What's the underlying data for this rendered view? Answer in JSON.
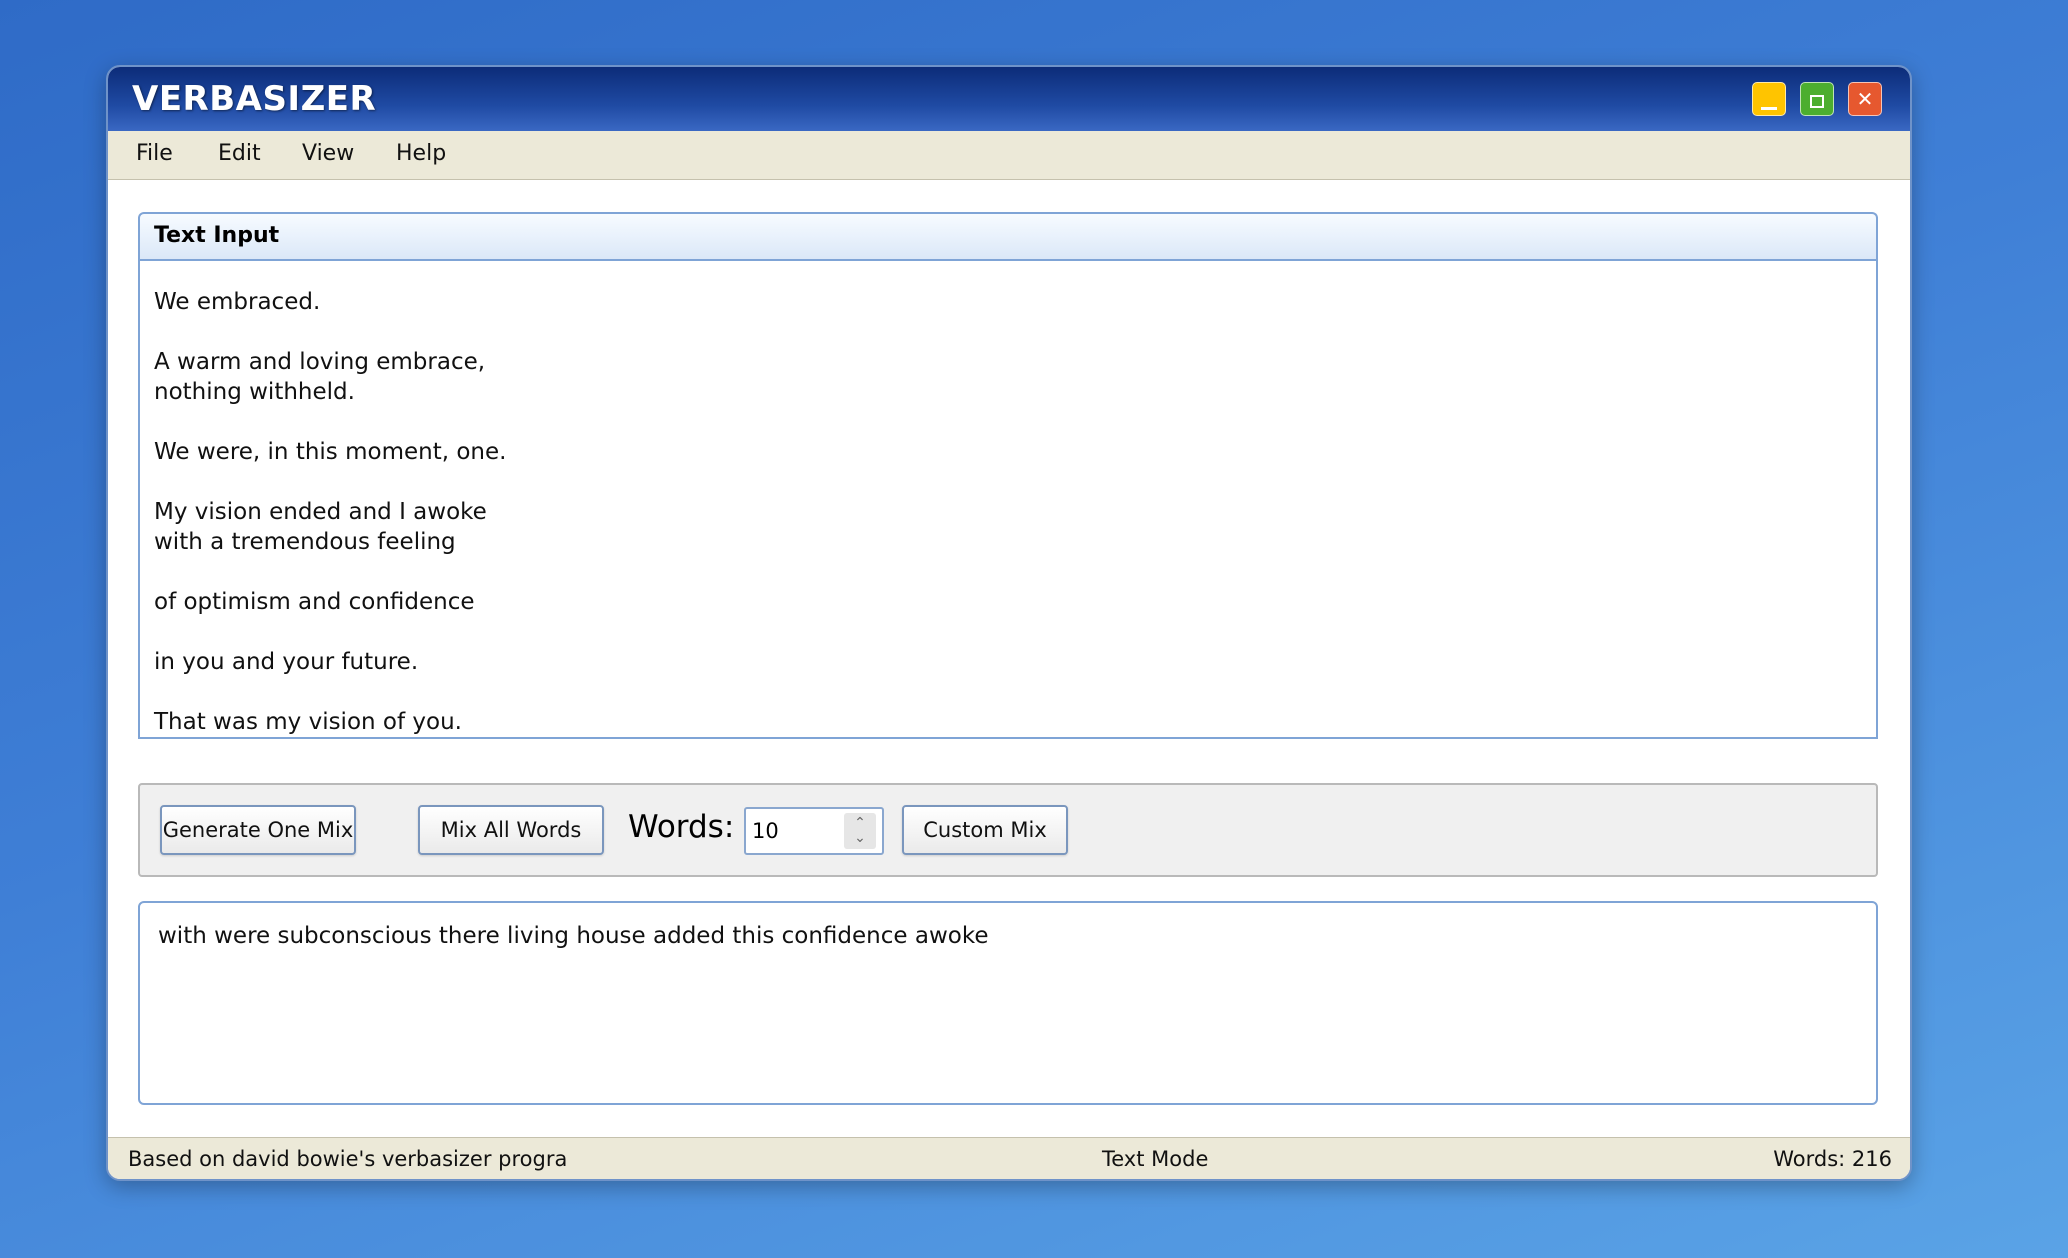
{
  "window": {
    "title": "VERBASIZER",
    "controls": {
      "minimize_icon": "minimize-icon",
      "maximize_icon": "maximize-icon",
      "close_icon": "close-icon",
      "close_glyph": "✕"
    }
  },
  "menu": {
    "items": [
      {
        "label": "File"
      },
      {
        "label": "Edit"
      },
      {
        "label": "View"
      },
      {
        "label": "Help"
      }
    ]
  },
  "input_panel": {
    "title": "Text Input",
    "lines": [
      "We embraced.",
      "",
      "A warm and loving embrace,",
      "nothing withheld.",
      "",
      "We were, in this moment, one.",
      "",
      "My vision ended and I awoke",
      "with a tremendous feeling",
      "",
      "of optimism and confidence",
      "",
      "in you and your future.",
      "",
      "That was my vision of you."
    ]
  },
  "controls": {
    "generate_one_label": "Generate One Mix",
    "mix_all_label": "Mix All Words",
    "words_label": "Words:",
    "words_value": "10",
    "custom_mix_label": "Custom Mix"
  },
  "output": {
    "text": "with were subconscious there living house added this confidence awoke"
  },
  "status": {
    "left": "Based on david bowie's verbasizer progra",
    "center": "Text Mode",
    "right": "Words: 216"
  },
  "colors": {
    "titlebar": "#1f4aa3",
    "minimize": "#ffc400",
    "maximize": "#4cae2f",
    "close": "#e6582f",
    "chrome": "#ece9d8",
    "panel_border": "#7fa4d6"
  }
}
